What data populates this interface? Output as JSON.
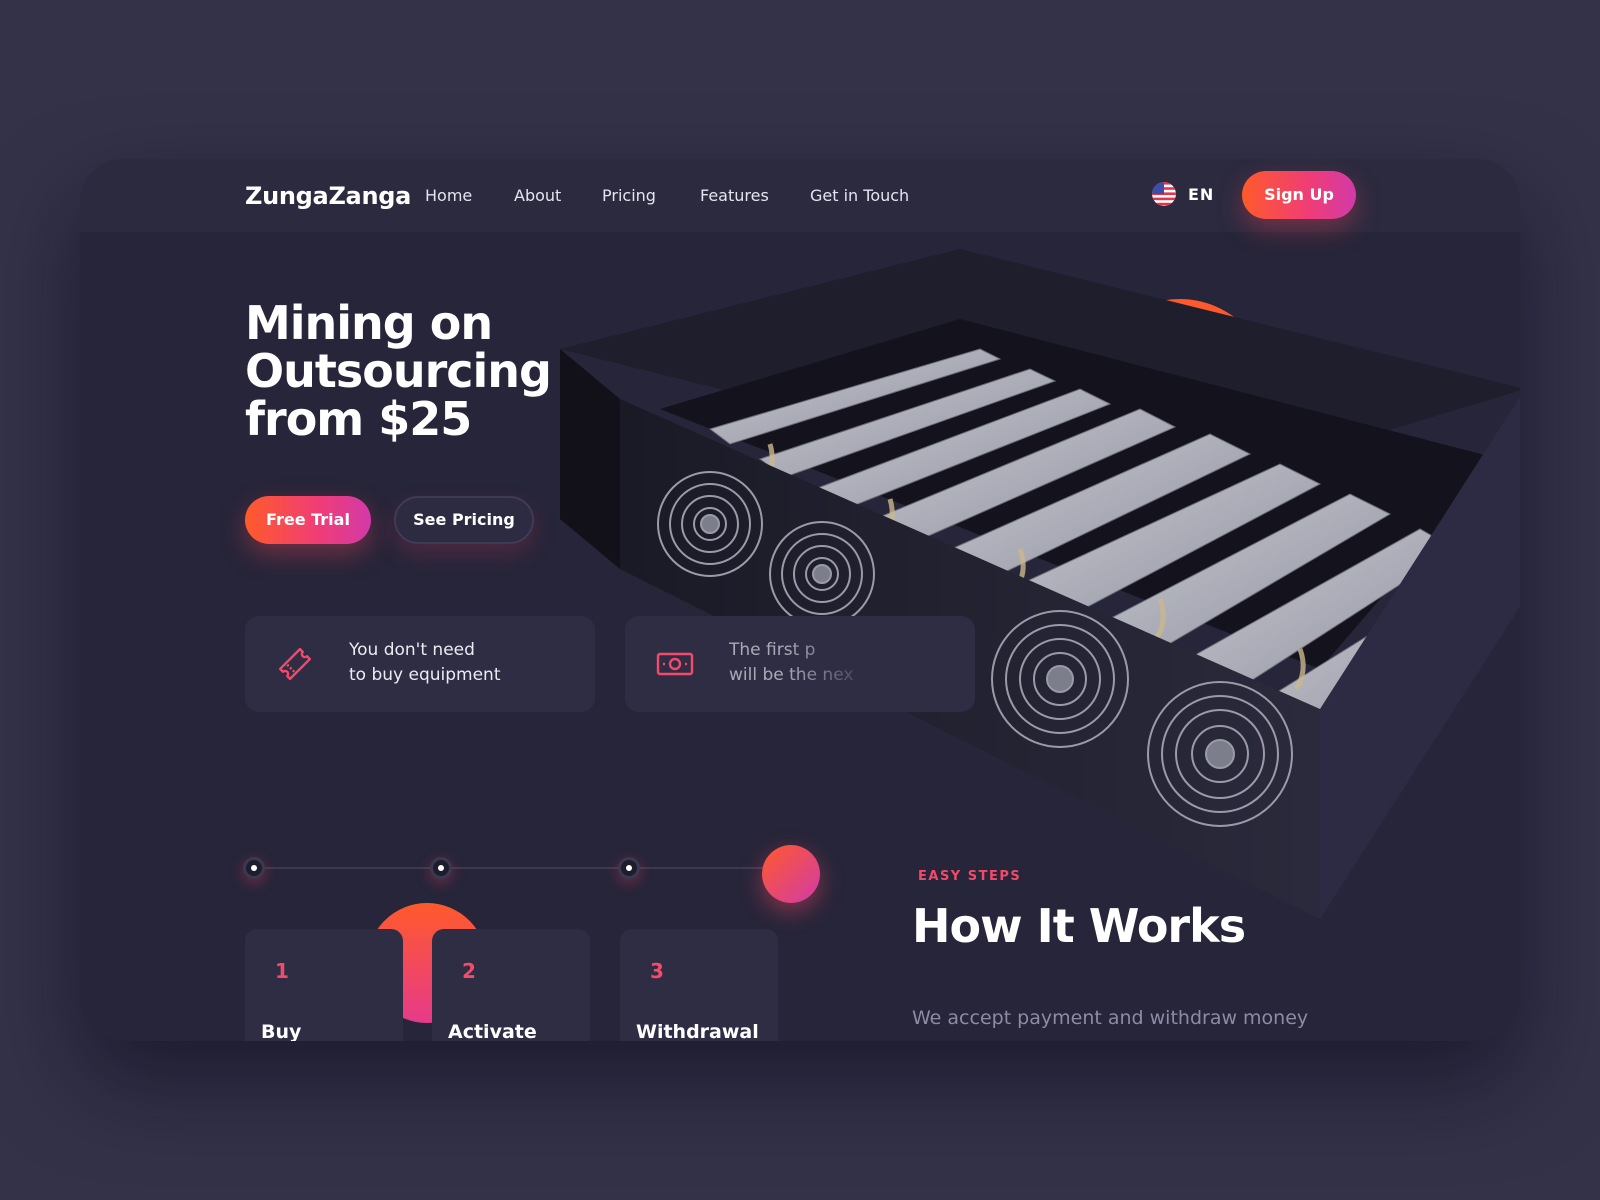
{
  "brand": {
    "name": "ZungaZanga"
  },
  "nav": {
    "links": [
      "Home",
      "About",
      "Pricing",
      "Features",
      "Get in Touch"
    ],
    "language": "EN",
    "signup_label": "Sign Up"
  },
  "hero": {
    "title_lines": [
      "Mining on",
      "Outsourcing",
      "from $25"
    ],
    "primary_cta": "Free Trial",
    "secondary_cta": "See Pricing"
  },
  "features": [
    {
      "icon": "ticket-icon",
      "lines": [
        "You don't need",
        "to buy equipment"
      ]
    },
    {
      "icon": "money-icon",
      "lines": [
        "The first p",
        "will be the nex"
      ]
    }
  ],
  "steps": {
    "eyebrow": "EASY STEPS",
    "title": "How It Works",
    "description": "We accept payment and withdraw money",
    "items": [
      {
        "number": "1",
        "label": "Buy"
      },
      {
        "number": "2",
        "label": "Activate"
      },
      {
        "number": "3",
        "label": "Withdrawal"
      }
    ]
  },
  "colors": {
    "background": "#343249",
    "card": "#262539",
    "accent_orange": "#ff5a2b",
    "accent_pink": "#d23aa8",
    "accent_red": "#f5496a"
  }
}
